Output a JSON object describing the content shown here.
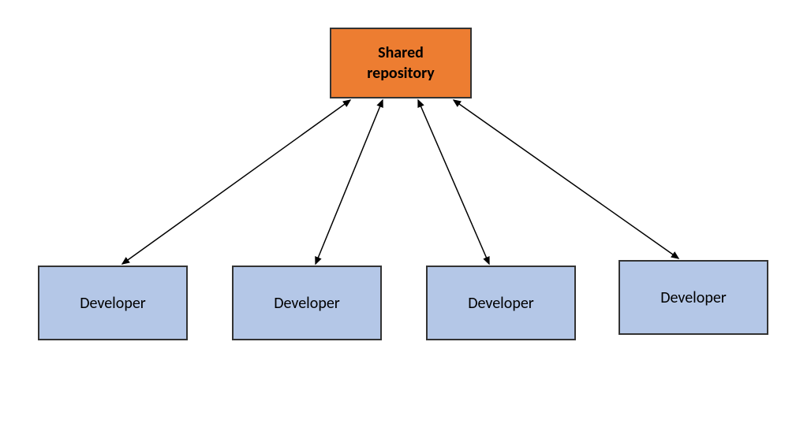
{
  "central": {
    "label": "Shared\nrepository",
    "color": "#ED7D31"
  },
  "nodes": [
    {
      "label": "Developer"
    },
    {
      "label": "Developer"
    },
    {
      "label": "Developer"
    },
    {
      "label": "Developer"
    }
  ],
  "node_color": "#B4C7E7",
  "connections": [
    {
      "from": "central",
      "to": 0,
      "bidirectional": true
    },
    {
      "from": "central",
      "to": 1,
      "bidirectional": true
    },
    {
      "from": "central",
      "to": 2,
      "bidirectional": true
    },
    {
      "from": "central",
      "to": 3,
      "bidirectional": true
    }
  ]
}
